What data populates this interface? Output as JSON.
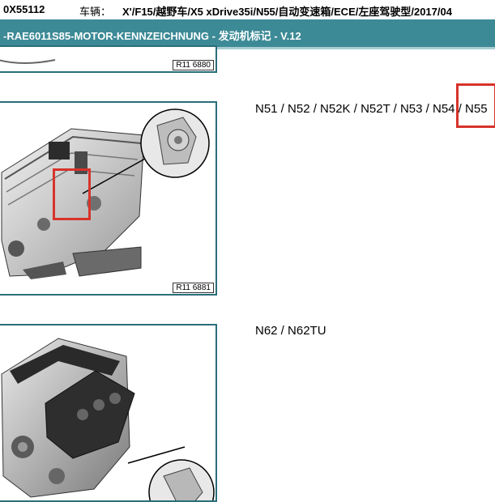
{
  "vehicle": {
    "vin": "0X55112",
    "label": "车辆：",
    "description": "X'/F15/越野车/X5 xDrive35i/N55/自动变速箱/ECE/左座驾驶型/2017/04"
  },
  "document": {
    "title": "-RAE6011S85-MOTOR-KENNZEICHNUNG - 发动机标记 - V.12"
  },
  "figures": [
    {
      "figure_number": "R11 6880",
      "caption": ""
    },
    {
      "figure_number": "R11 6881",
      "caption": "N51 / N52 / N52K / N52T / N53 / N54 / N55"
    },
    {
      "figure_number": "",
      "caption": "N62 / N62TU"
    }
  ],
  "colors": {
    "header_bg": "#3c8a96",
    "frame_border": "#2a6f7b",
    "highlight": "#d7332b"
  }
}
